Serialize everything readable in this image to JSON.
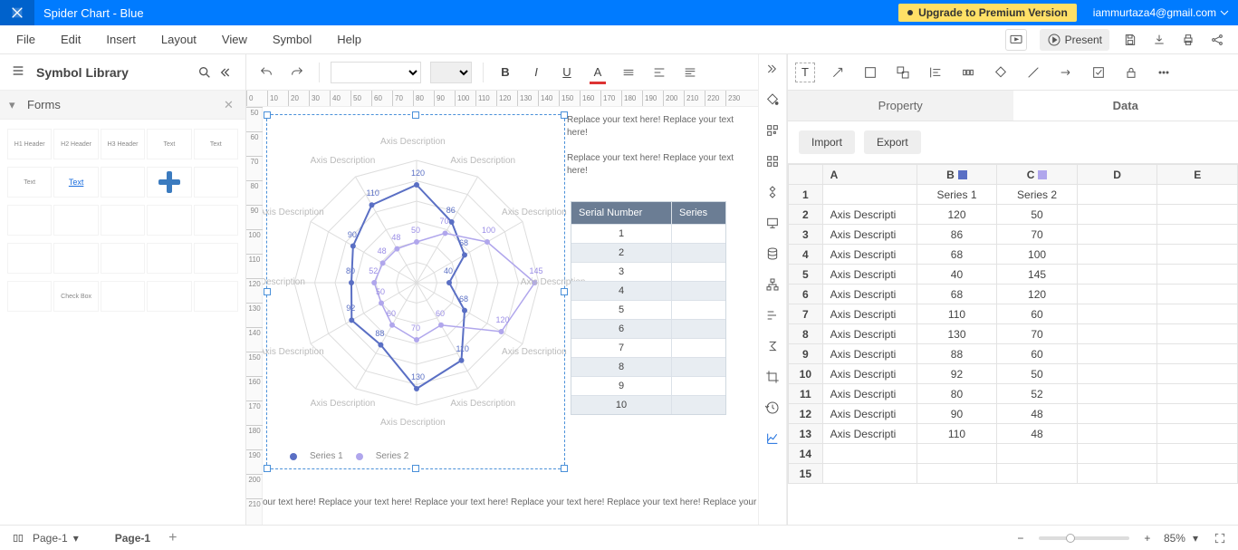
{
  "titlebar": {
    "title": "Spider Chart - Blue",
    "upgrade": "Upgrade to Premium Version",
    "account": "iammurtaza4@gmail.com"
  },
  "menu": {
    "items": [
      "File",
      "Edit",
      "Insert",
      "Layout",
      "View",
      "Symbol",
      "Help"
    ],
    "present": "Present"
  },
  "left": {
    "lib_title": "Symbol Library",
    "forms": "Forms",
    "thumbs": [
      "H1 Header",
      "H2 Header",
      "H3 Header",
      "Text",
      "Text",
      "Text",
      "Text",
      "",
      "",
      "",
      "",
      "",
      "",
      "",
      "",
      "",
      "",
      "",
      "",
      "",
      "",
      "Check Box",
      "",
      "",
      ""
    ]
  },
  "canvas": {
    "ruler_h": [
      0,
      10,
      20,
      30,
      40,
      50,
      60,
      70,
      80,
      90,
      100,
      110,
      120,
      130,
      140,
      150,
      160,
      170,
      180,
      190,
      200,
      210,
      220,
      230
    ],
    "ruler_v": [
      50,
      60,
      70,
      80,
      90,
      100,
      110,
      120,
      130,
      140,
      150,
      160,
      170,
      180,
      190,
      200,
      210
    ],
    "placeholder": "Replace your text here!  Replace your text here!",
    "placeholder_bottom": "our text here!  Replace your text here!  Replace your text here!  Replace your text here!  Replace your text here!  Replace your t",
    "axis_label": "Axis Description",
    "legend": [
      "Series 1",
      "Series 2"
    ],
    "table": {
      "headers": [
        "Serial Number",
        "Series"
      ],
      "rows": [
        "1",
        "2",
        "3",
        "4",
        "5",
        "6",
        "7",
        "8",
        "9",
        "10"
      ]
    }
  },
  "right": {
    "tabs": [
      "Property",
      "Data"
    ],
    "buttons": [
      "Import",
      "Export"
    ],
    "columns": [
      "A",
      "B",
      "C",
      "D",
      "E"
    ],
    "header_row": [
      "",
      "Series 1",
      "Series 2",
      "",
      ""
    ],
    "rows": [
      [
        "Axis Descripti",
        "120",
        "50",
        "",
        ""
      ],
      [
        "Axis Descripti",
        "86",
        "70",
        "",
        ""
      ],
      [
        "Axis Descripti",
        "68",
        "100",
        "",
        ""
      ],
      [
        "Axis Descripti",
        "40",
        "145",
        "",
        ""
      ],
      [
        "Axis Descripti",
        "68",
        "120",
        "",
        ""
      ],
      [
        "Axis Descripti",
        "110",
        "60",
        "",
        ""
      ],
      [
        "Axis Descripti",
        "130",
        "70",
        "",
        ""
      ],
      [
        "Axis Descripti",
        "88",
        "60",
        "",
        ""
      ],
      [
        "Axis Descripti",
        "92",
        "50",
        "",
        ""
      ],
      [
        "Axis Descripti",
        "80",
        "52",
        "",
        ""
      ],
      [
        "Axis Descripti",
        "90",
        "48",
        "",
        ""
      ],
      [
        "Axis Descripti",
        "110",
        "48",
        "",
        ""
      ],
      [
        "",
        "",
        "",
        "",
        ""
      ],
      [
        "",
        "",
        "",
        "",
        ""
      ]
    ]
  },
  "status": {
    "page_sel": "Page-1",
    "page_tab": "Page-1",
    "zoom": "85%"
  },
  "chart_data": {
    "type": "radar",
    "title": "Spider Chart - Blue",
    "axes": [
      "Axis Description",
      "Axis Description",
      "Axis Description",
      "Axis Description",
      "Axis Description",
      "Axis Description",
      "Axis Description",
      "Axis Description",
      "Axis Description",
      "Axis Description",
      "Axis Description",
      "Axis Description"
    ],
    "max": 150,
    "grid_rings": 6,
    "series": [
      {
        "name": "Series 1",
        "color": "#5a6fc4",
        "values": [
          120,
          86,
          68,
          40,
          68,
          110,
          130,
          88,
          92,
          80,
          90,
          110
        ]
      },
      {
        "name": "Series 2",
        "color": "#b0a6ec",
        "values": [
          50,
          70,
          100,
          145,
          120,
          60,
          70,
          60,
          50,
          52,
          48,
          48
        ]
      }
    ],
    "legend_position": "bottom"
  }
}
